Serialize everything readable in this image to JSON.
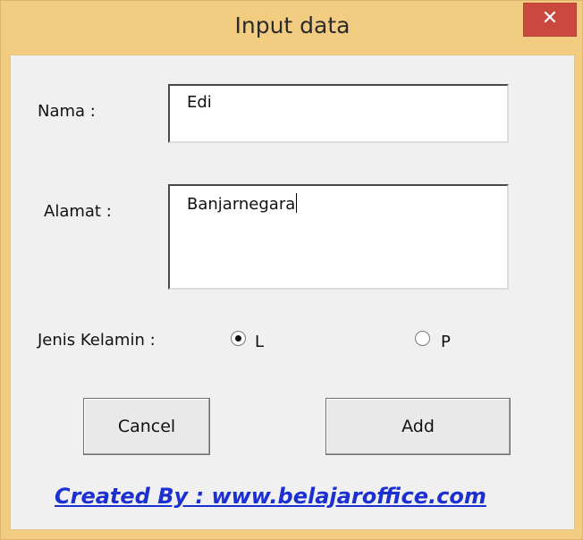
{
  "window": {
    "title": "Input data",
    "close_glyph": "✕"
  },
  "form": {
    "nama_label": "Nama :",
    "nama_value": "Edi",
    "alamat_label": "Alamat :",
    "alamat_value": "Banjarnegara",
    "gender_label": "Jenis Kelamin :",
    "gender_options": [
      {
        "label": "L",
        "selected": true
      },
      {
        "label": "P",
        "selected": false
      }
    ]
  },
  "buttons": {
    "cancel": "Cancel",
    "add": "Add"
  },
  "footer": {
    "credit": "Created By : www.belajaroffice.com"
  },
  "colors": {
    "title_bar": "#f2cc80",
    "close_button": "#c9493e",
    "link": "#1c2fd0"
  }
}
